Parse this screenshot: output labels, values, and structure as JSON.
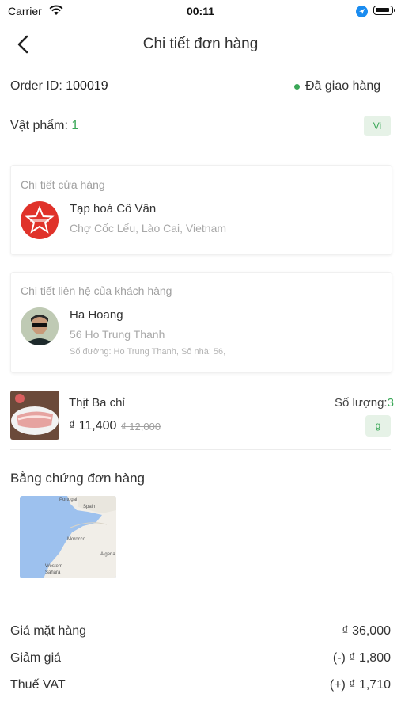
{
  "status_bar": {
    "carrier": "Carrier",
    "time": "00:11"
  },
  "header": {
    "title": "Chi tiết đơn hàng"
  },
  "order": {
    "id_label": "Order ID:",
    "id_value": "100019",
    "status": "Đã giao hàng",
    "items_label": "Vật phẩm:",
    "items_count": "1",
    "unit_chip": "Vi"
  },
  "store": {
    "section_title": "Chi tiết cửa hàng",
    "name": "Tạp hoá Cô Vân",
    "address": "Chợ Cốc Lếu, Lào Cai, Vietnam"
  },
  "customer": {
    "section_title": "Chi tiết liên hệ của khách hàng",
    "name": "Ha Hoang",
    "address": "56 Ho Trung Thanh",
    "detail": "Số đường: Ho Trung Thanh, Số nhà: 56,"
  },
  "product": {
    "name": "Thịt Ba chỉ",
    "price": "₫ 11,400",
    "old_price": "₫ 12,000",
    "qty_label": "Số lượng:",
    "qty": "3",
    "unit": "g"
  },
  "proof": {
    "title": "Bằng chứng đơn hàng",
    "map_labels": [
      "Portugal",
      "Spain",
      "Morocco",
      "Algeria",
      "Western Sahara"
    ]
  },
  "summary": [
    {
      "label": "Giá mặt hàng",
      "value": "₫ 36,000"
    },
    {
      "label": "Giảm giá",
      "value": "(-) ₫ 1,800"
    },
    {
      "label": "Thuế VAT",
      "value": "(+) ₫ 1,710"
    }
  ],
  "colors": {
    "accent": "#3aa757",
    "store_logo": "#e0322a",
    "location_dot": "#1a8cf0"
  }
}
